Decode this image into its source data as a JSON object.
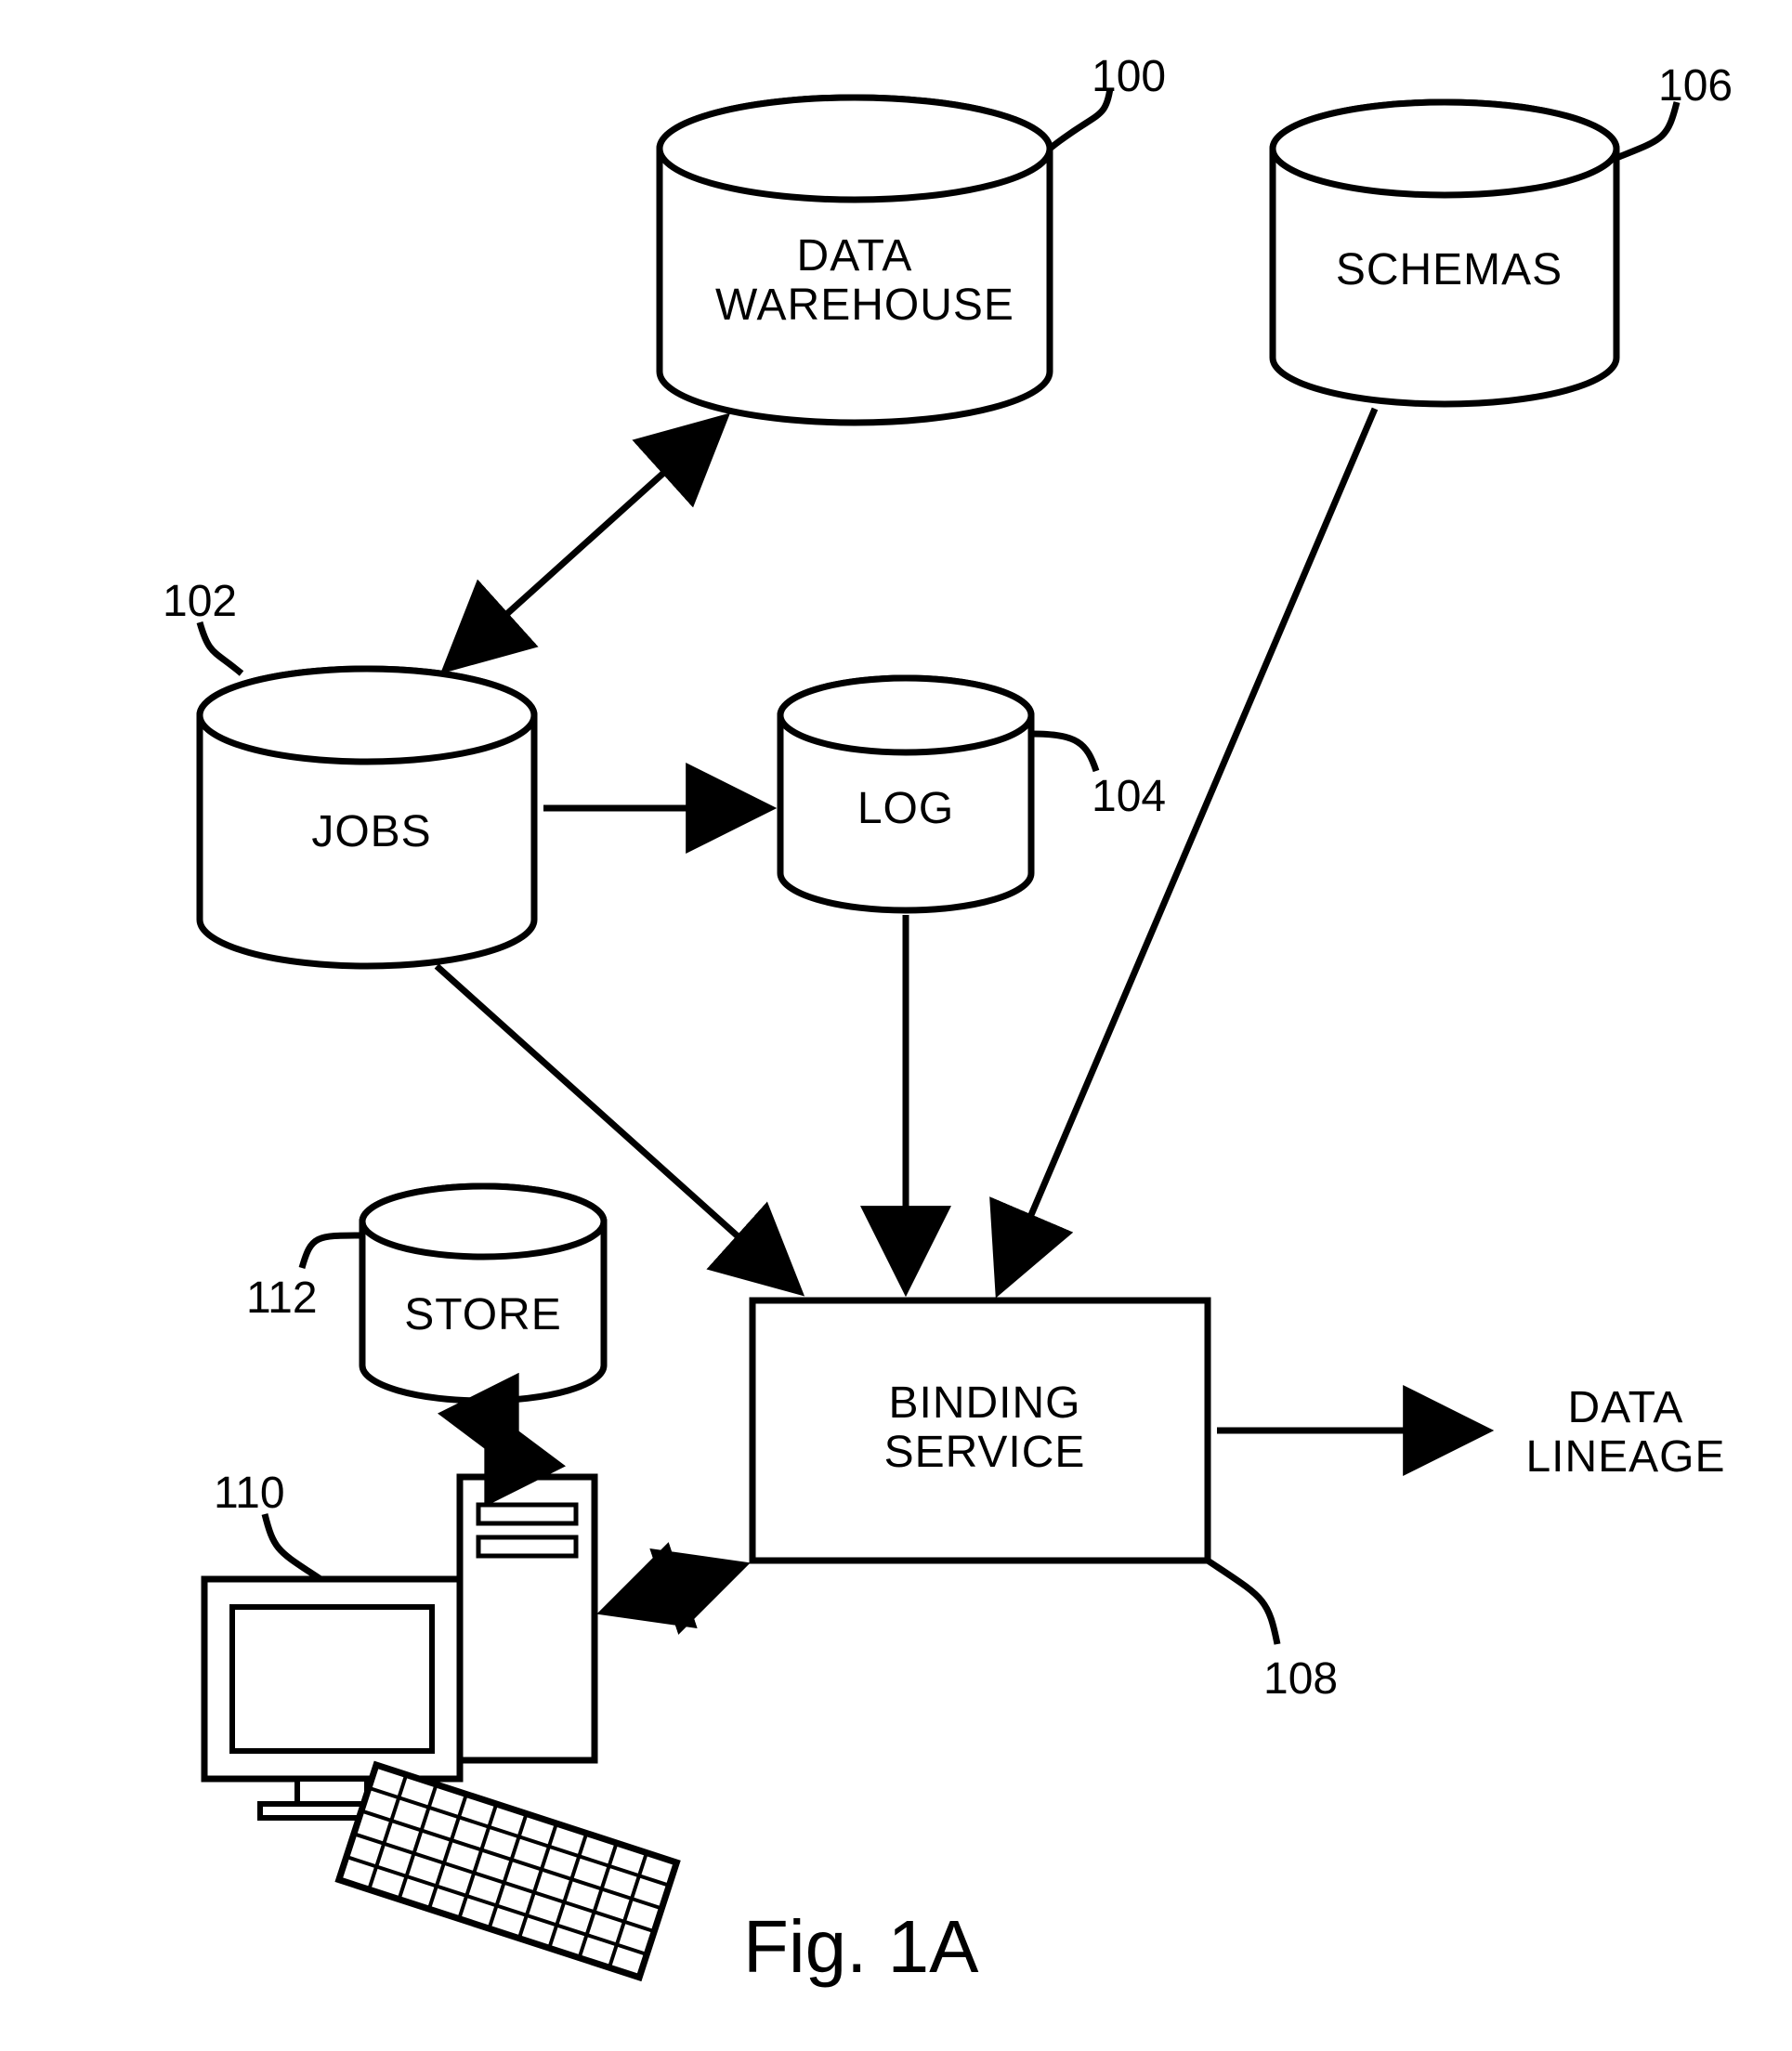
{
  "figure_label": "Fig. 1A",
  "nodes": {
    "data_warehouse": {
      "label": "DATA\nWAREHOUSE",
      "ref": "100"
    },
    "jobs": {
      "label": "JOBS",
      "ref": "102"
    },
    "log": {
      "label": "LOG",
      "ref": "104"
    },
    "schemas": {
      "label": "SCHEMAS",
      "ref": "106"
    },
    "binding": {
      "label": "BINDING\nSERVICE",
      "ref": "108"
    },
    "computer": {
      "label": "",
      "ref": "110"
    },
    "store": {
      "label": "STORE",
      "ref": "112"
    }
  },
  "outputs": {
    "data_lineage": "DATA\nLINEAGE"
  },
  "edges": [
    {
      "from": "jobs",
      "to": "data_warehouse",
      "bidir": true
    },
    {
      "from": "jobs",
      "to": "log",
      "bidir": false
    },
    {
      "from": "jobs",
      "to": "binding",
      "bidir": false
    },
    {
      "from": "log",
      "to": "binding",
      "bidir": false
    },
    {
      "from": "schemas",
      "to": "binding",
      "bidir": false
    },
    {
      "from": "binding",
      "to": "data_lineage",
      "bidir": false
    },
    {
      "from": "store",
      "to": "computer",
      "bidir": true
    },
    {
      "from": "computer",
      "to": "binding",
      "bidir": true
    }
  ]
}
